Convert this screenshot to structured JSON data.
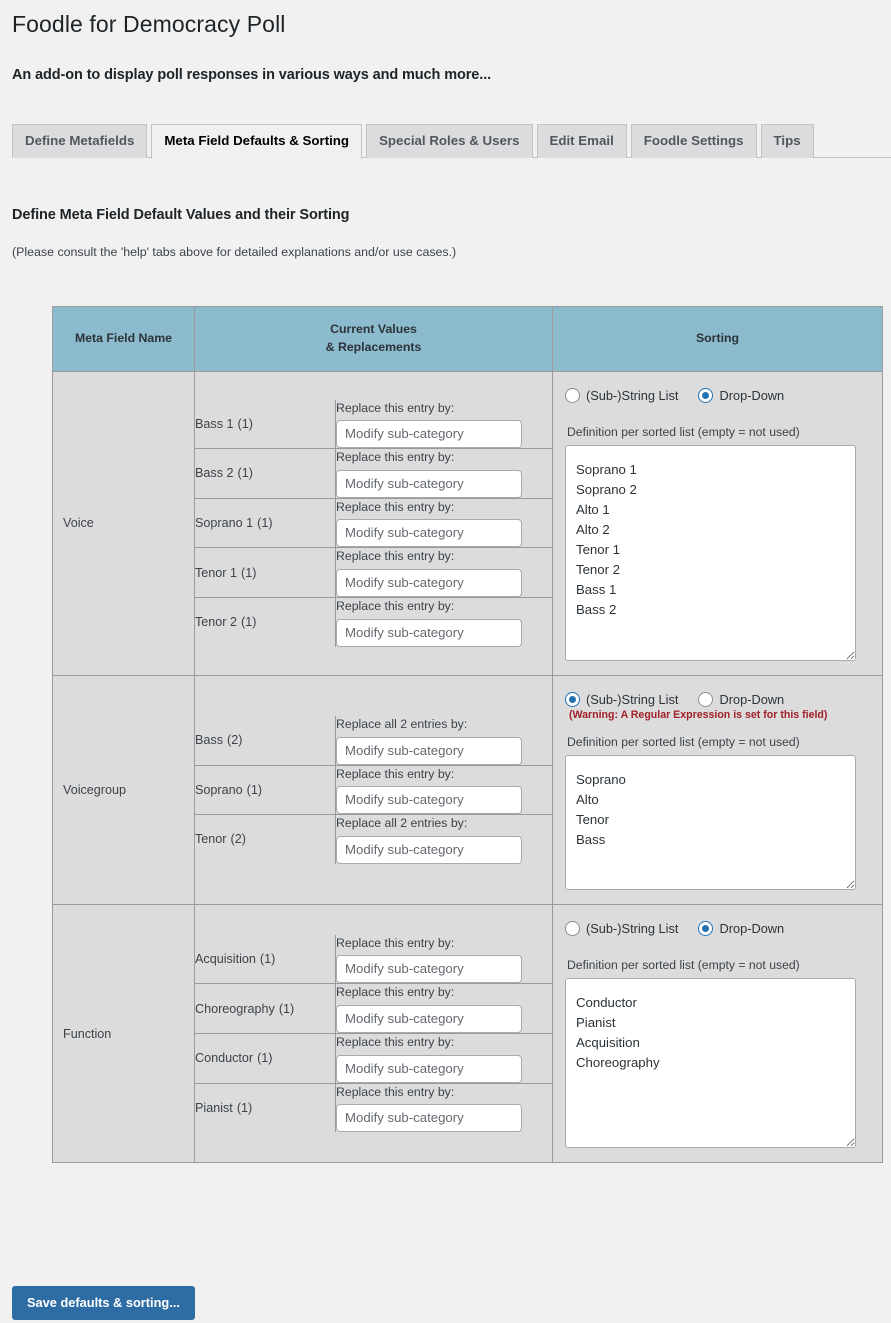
{
  "header": {
    "title": "Foodle for Democracy Poll",
    "subtitle": "An add-on to display poll responses in various ways and much more..."
  },
  "tabs": [
    {
      "label": "Define Metafields",
      "active": false
    },
    {
      "label": "Meta Field Defaults & Sorting",
      "active": true
    },
    {
      "label": "Special Roles & Users",
      "active": false
    },
    {
      "label": "Edit Email",
      "active": false
    },
    {
      "label": "Foodle Settings",
      "active": false
    },
    {
      "label": "Tips",
      "active": false
    }
  ],
  "section": {
    "heading": "Define Meta Field Default Values and their Sorting",
    "note": "(Please consult the 'help' tabs above for detailed explanations and/or use cases.)"
  },
  "table": {
    "columns": {
      "meta_field_name": "Meta Field Name",
      "current_values_line1": "Current Values",
      "current_values_line2": "& Replacements",
      "sorting": "Sorting"
    },
    "common": {
      "replace_input_placeholder": "Modify sub-category",
      "definition_label": "Definition per sorted list (empty = not used)",
      "radio_substring_label": "(Sub-)String List",
      "radio_dropdown_label": "Drop-Down"
    },
    "rows": [
      {
        "name": "Voice",
        "entries": [
          {
            "label": "Bass 1",
            "count": "(1)",
            "replace_label": "Replace this entry by:",
            "value": ""
          },
          {
            "label": "Bass 2",
            "count": "(1)",
            "replace_label": "Replace this entry by:",
            "value": ""
          },
          {
            "label": "Soprano 1",
            "count": "(1)",
            "replace_label": "Replace this entry by:",
            "value": ""
          },
          {
            "label": "Tenor 1",
            "count": "(1)",
            "replace_label": "Replace this entry by:",
            "value": ""
          },
          {
            "label": "Tenor 2",
            "count": "(1)",
            "replace_label": "Replace this entry by:",
            "value": ""
          }
        ],
        "sorting": {
          "selected": "dropdown",
          "warning": "",
          "definition": "Soprano 1\nSoprano 2\nAlto 1\nAlto 2\nTenor 1\nTenor 2\nBass 1\nBass 2"
        }
      },
      {
        "name": "Voicegroup",
        "entries": [
          {
            "label": "Bass",
            "count": "(2)",
            "replace_label": "Replace all 2 entries by:",
            "value": ""
          },
          {
            "label": "Soprano",
            "count": "(1)",
            "replace_label": "Replace this entry by:",
            "value": ""
          },
          {
            "label": "Tenor",
            "count": "(2)",
            "replace_label": "Replace all 2 entries by:",
            "value": ""
          }
        ],
        "sorting": {
          "selected": "substring",
          "warning": "(Warning: A Regular Expression is set for this field)",
          "definition": "Soprano\nAlto\nTenor\nBass"
        }
      },
      {
        "name": "Function",
        "entries": [
          {
            "label": "Acquisition",
            "count": "(1)",
            "replace_label": "Replace this entry by:",
            "value": ""
          },
          {
            "label": "Choreography",
            "count": "(1)",
            "replace_label": "Replace this entry by:",
            "value": ""
          },
          {
            "label": "Conductor",
            "count": "(1)",
            "replace_label": "Replace this entry by:",
            "value": ""
          },
          {
            "label": "Pianist",
            "count": "(1)",
            "replace_label": "Replace this entry by:",
            "value": ""
          }
        ],
        "sorting": {
          "selected": "dropdown",
          "warning": "",
          "definition": "Conductor\nPianist\nAcquisition\nChoreography"
        }
      }
    ]
  },
  "footer": {
    "save_label": "Save defaults & sorting..."
  },
  "colors": {
    "page_background": "#f1f1f1",
    "table_header": "#8cbbcd",
    "table_body": "#dcdcdc",
    "accent_blue": "#2271b1",
    "button_blue": "#2e6da4",
    "warning_red": "#a02128"
  }
}
